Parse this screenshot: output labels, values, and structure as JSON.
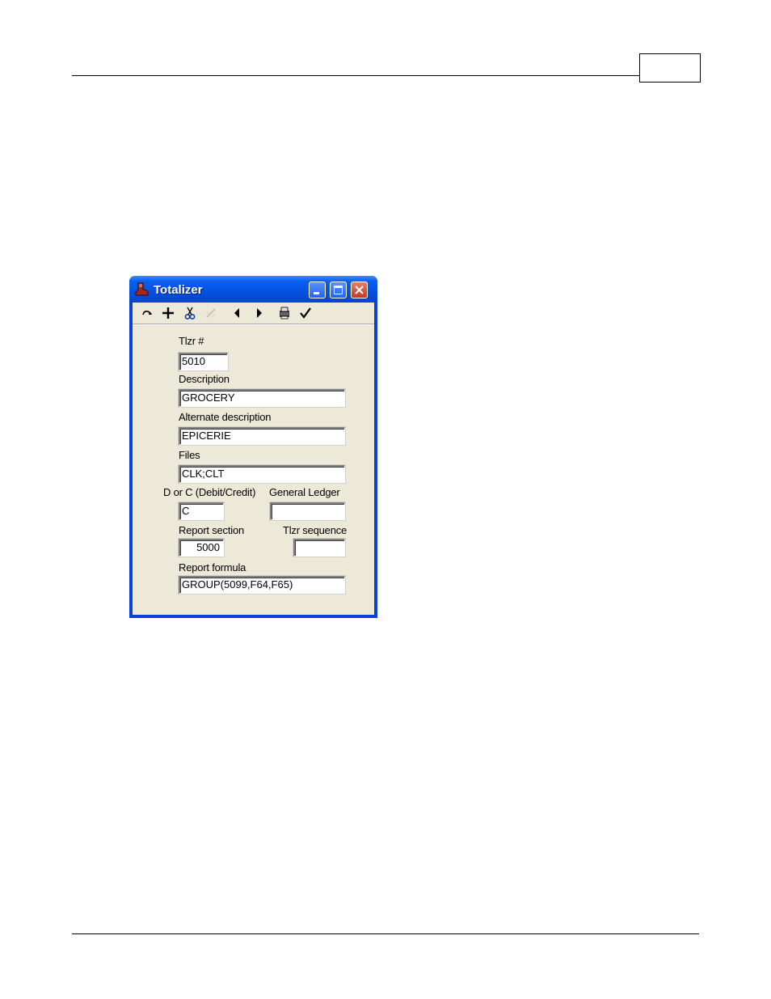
{
  "window": {
    "title": "Totalizer",
    "icon": "boot-icon"
  },
  "toolbar": {
    "icons": [
      "redo-icon",
      "add-icon",
      "cut-icon",
      "disabled-edit-icon",
      "previous-icon",
      "next-icon",
      "print-icon",
      "checkmark-icon"
    ]
  },
  "form": {
    "tlzr_label": "Tlzr #",
    "tlzr_value": "5010",
    "description_label": "Description",
    "description_value": "GROCERY",
    "alt_description_label": "Alternate description",
    "alt_description_value": "EPICERIE",
    "files_label": "Files",
    "files_value": "CLK;CLT",
    "dc_label": "D or C (Debit/Credit)",
    "dc_value": "C",
    "gl_label": "General Ledger",
    "gl_value": "",
    "report_section_label": "Report section",
    "report_section_value": "5000",
    "tlzr_sequence_label": "Tlzr sequence",
    "tlzr_sequence_value": "",
    "report_formula_label": "Report formula",
    "report_formula_value": "GROUP(5099,F64,F65)"
  },
  "colors": {
    "titlebar": "#0a5ff0",
    "dialog_bg": "#ece9d8",
    "close_button": "#c4361c"
  }
}
